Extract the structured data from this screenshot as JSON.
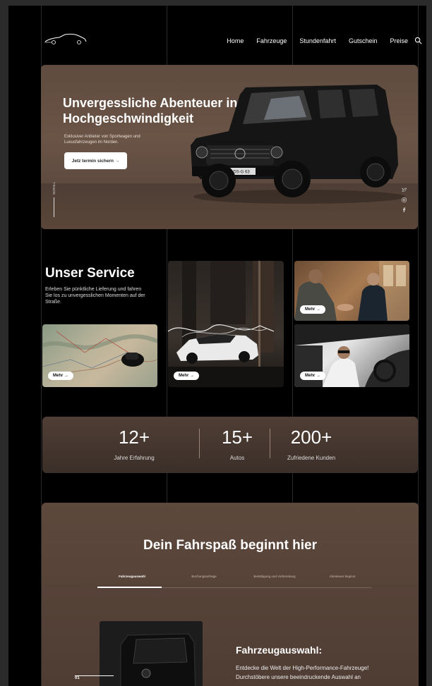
{
  "nav": {
    "items": [
      {
        "label": "Home"
      },
      {
        "label": "Fahrzeuge"
      },
      {
        "label": "Stundenfahrt"
      },
      {
        "label": "Gutschein"
      },
      {
        "label": "Preise"
      }
    ],
    "search_icon": "search-icon"
  },
  "hero": {
    "title": "Unvergessliche Abenteuer in Hochgeschwindigkeit",
    "subtitle": "Exklusiver Anbieter von Sportwagen und Luxusfahrzeugen im Norden.",
    "cta": "Jetz termin sichern →",
    "scroll": "SCROLL",
    "plate": "DS-G 63",
    "socials": [
      "twitter-icon",
      "instagram-icon",
      "facebook-icon"
    ]
  },
  "services": {
    "title": "Unser Service",
    "text": "Erleben Sie pünktliche Lieferung und fahren Sie los zu unvergesslichen Momenten auf der Straße.",
    "more_label": "Mehr →"
  },
  "stats": [
    {
      "value": "12+",
      "label": "Jahre Erfahrung"
    },
    {
      "value": "15+",
      "label": "Autos"
    },
    {
      "value": "200+",
      "label": "Zufriedene Kunden"
    }
  ],
  "journey": {
    "title": "Dein Fahrspaß beginnt hier",
    "tabs": [
      {
        "label": "Fahrzeugauswahl"
      },
      {
        "label": "Buchungsanfrage"
      },
      {
        "label": "Bestätigung und Vorbereitung"
      },
      {
        "label": "Abenteuer beginnt"
      }
    ],
    "step_number": "01",
    "heading": "Fahrzeugauswahl:",
    "text": "Entdecke die Welt der High-Performance-Fahrzeuge! Durchstöbere unsere beeindruckende Auswahl an"
  },
  "colors": {
    "accent_brown": "#5f4b3f",
    "background": "#000000"
  }
}
